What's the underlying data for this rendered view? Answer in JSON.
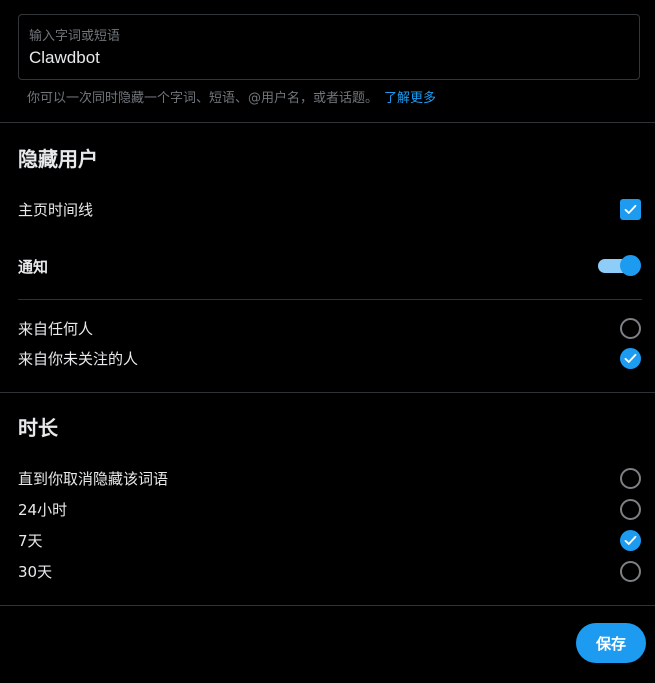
{
  "input": {
    "label": "输入字词或短语",
    "value": "Clawdbot"
  },
  "helper": {
    "text": "你可以一次同时隐藏一个字词、短语、@用户名，或者话题。",
    "link": "了解更多"
  },
  "hide_users": {
    "title": "隐藏用户",
    "home_timeline": {
      "label": "主页时间线",
      "checked": true
    },
    "notifications": {
      "label": "通知",
      "on": true
    },
    "audience": [
      {
        "label": "来自任何人",
        "selected": false
      },
      {
        "label": "来自你未关注的人",
        "selected": true
      }
    ]
  },
  "duration": {
    "title": "时长",
    "options": [
      {
        "label": "直到你取消隐藏该词语",
        "selected": false
      },
      {
        "label": "24小时",
        "selected": false
      },
      {
        "label": "7天",
        "selected": true
      },
      {
        "label": "30天",
        "selected": false
      }
    ]
  },
  "footer": {
    "save_label": "保存"
  },
  "colors": {
    "accent": "#1d9bf0",
    "background": "#000000",
    "text": "#e7e9ea",
    "muted": "#71767b",
    "divider": "#2f3336"
  },
  "icons": {
    "check": "checkmark-icon"
  }
}
